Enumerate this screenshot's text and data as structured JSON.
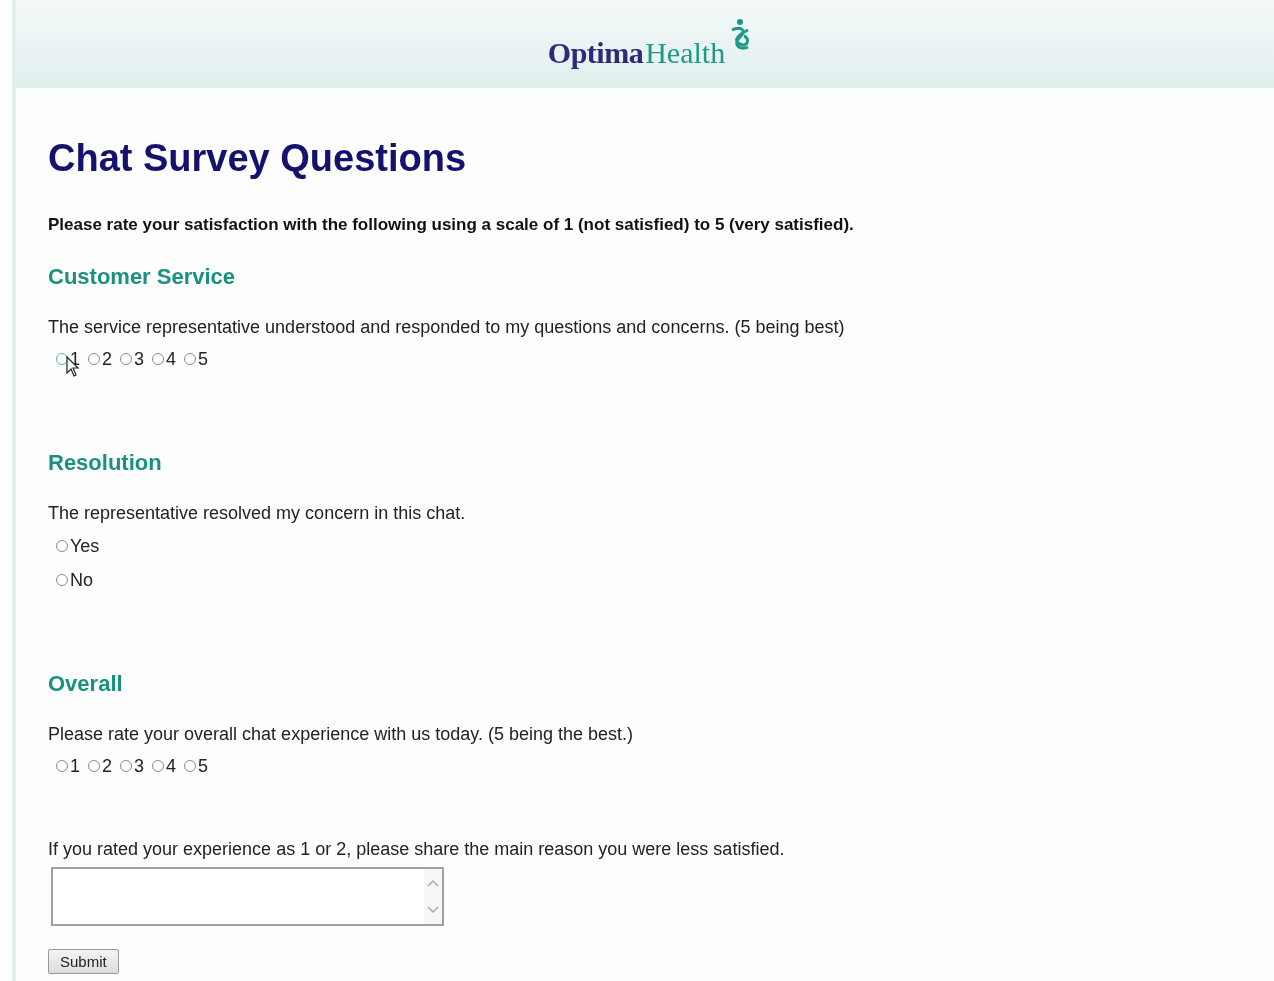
{
  "header": {
    "logo": {
      "word_1": "Optima",
      "word_2": "Health"
    }
  },
  "title": "Chat Survey Questions",
  "instructions": "Please rate your satisfaction with the following using a scale of 1 (not satisfied) to 5 (very satisfied).",
  "sections": [
    {
      "heading": "Customer Service",
      "question": "The service representative understood and responded to my questions and concerns. (5 being best)",
      "kind": "inline",
      "options": [
        {
          "label": "1",
          "selected": false,
          "hovered": true
        },
        {
          "label": "2",
          "selected": false,
          "hovered": false
        },
        {
          "label": "3",
          "selected": false,
          "hovered": false
        },
        {
          "label": "4",
          "selected": false,
          "hovered": false
        },
        {
          "label": "5",
          "selected": false,
          "hovered": false
        }
      ]
    },
    {
      "heading": "Resolution",
      "question": "The representative resolved my concern in this chat.",
      "kind": "stacked",
      "options": [
        {
          "label": "Yes",
          "selected": false,
          "hovered": false
        },
        {
          "label": "No",
          "selected": false,
          "hovered": false
        }
      ]
    },
    {
      "heading": "Overall",
      "question": "Please rate your overall chat experience with us today. (5 being the best.)",
      "kind": "inline",
      "options": [
        {
          "label": "1",
          "selected": false,
          "hovered": false
        },
        {
          "label": "2",
          "selected": false,
          "hovered": false
        },
        {
          "label": "3",
          "selected": false,
          "hovered": false
        },
        {
          "label": "4",
          "selected": false,
          "hovered": false
        },
        {
          "label": "5",
          "selected": false,
          "hovered": false
        }
      ]
    }
  ],
  "followup": {
    "question": "If you rated your experience as 1 or 2, please share the main reason you were less satisfied."
  },
  "submit": "Submit"
}
